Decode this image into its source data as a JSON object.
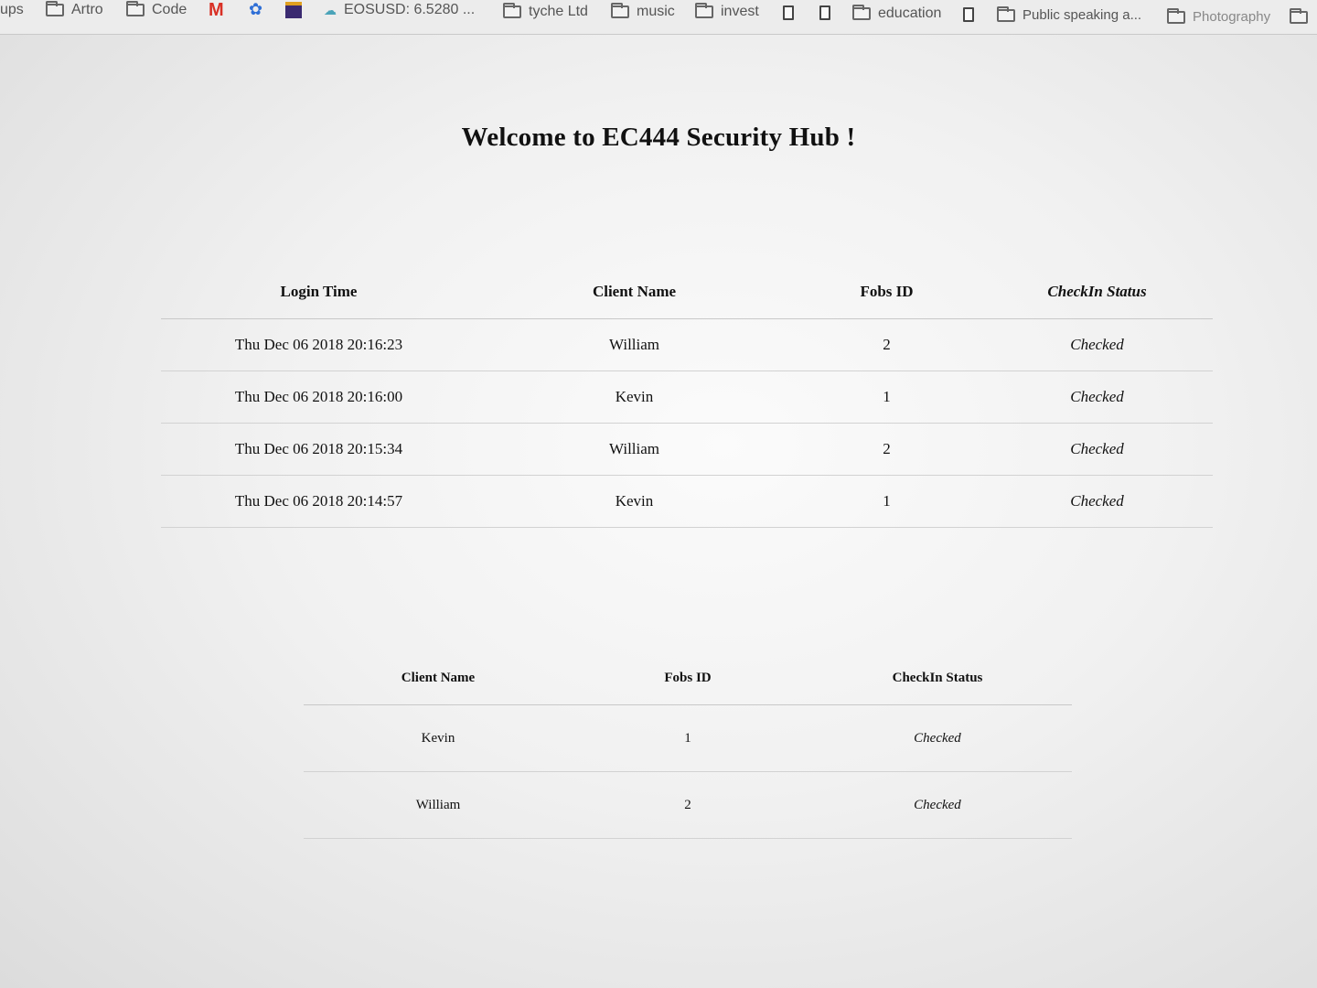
{
  "bookmarks": [
    {
      "label": "ups",
      "icon": "none"
    },
    {
      "label": "Artro",
      "icon": "folder-icon"
    },
    {
      "label": "Code",
      "icon": "folder-icon"
    },
    {
      "label": "",
      "icon": "gmail-icon"
    },
    {
      "label": "",
      "icon": "paw-icon"
    },
    {
      "label": "",
      "icon": "app-square-icon"
    },
    {
      "label": "EOSUSD: 6.5280 ...",
      "icon": "cloud-icon"
    },
    {
      "label": "tyche Ltd",
      "icon": "folder-icon"
    },
    {
      "label": "music",
      "icon": "folder-icon"
    },
    {
      "label": "invest",
      "icon": "folder-icon"
    },
    {
      "label": "",
      "icon": "document-icon"
    },
    {
      "label": "",
      "icon": "document-icon"
    },
    {
      "label": "education",
      "icon": "folder-icon"
    },
    {
      "label": "",
      "icon": "document-icon"
    },
    {
      "label": "Public speaking a...",
      "icon": "folder-icon"
    },
    {
      "label": "Photography",
      "icon": "folder-icon"
    },
    {
      "label": "",
      "icon": "folder-icon"
    }
  ],
  "page": {
    "title": "Welcome to EC444 Security Hub !"
  },
  "login_table": {
    "headers": [
      "Login Time",
      "Client Name",
      "Fobs ID",
      "CheckIn Status"
    ],
    "rows": [
      [
        "Thu Dec 06 2018 20:16:23",
        "William",
        "2",
        "Checked"
      ],
      [
        "Thu Dec 06 2018 20:16:00",
        "Kevin",
        "1",
        "Checked"
      ],
      [
        "Thu Dec 06 2018 20:15:34",
        "William",
        "2",
        "Checked"
      ],
      [
        "Thu Dec 06 2018 20:14:57",
        "Kevin",
        "1",
        "Checked"
      ]
    ]
  },
  "status_table": {
    "headers": [
      "Client Name",
      "Fobs ID",
      "CheckIn Status"
    ],
    "rows": [
      [
        "Kevin",
        "1",
        "Checked"
      ],
      [
        "William",
        "2",
        "Checked"
      ]
    ]
  }
}
